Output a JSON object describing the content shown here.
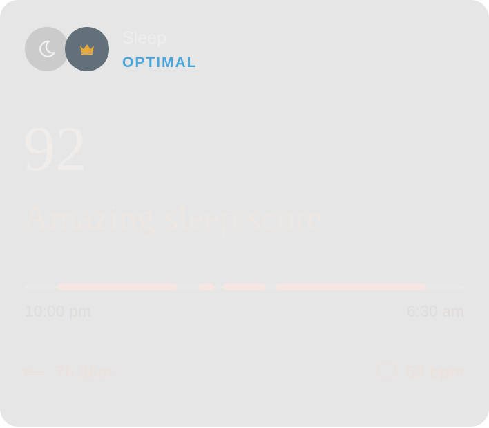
{
  "card": {
    "title": "Sleep",
    "status": "OPTIMAL",
    "score": "92",
    "score_label": "Amazing sleep score",
    "start_time": "10:00 pm",
    "end_time": "6:30 am",
    "duration": "7h 30m",
    "heart_rate": "53 bpm",
    "icons": {
      "moon": "moon-icon",
      "crown": "crown-icon",
      "bed": "bed-icon",
      "heart": "heart-icon"
    }
  },
  "colors": {
    "card_background": "#e6e6e6",
    "status": "#4aa7dc",
    "crown": "#e8a93a",
    "crown_circle": "#627079",
    "timeline_segment": "#f5e6e3"
  }
}
